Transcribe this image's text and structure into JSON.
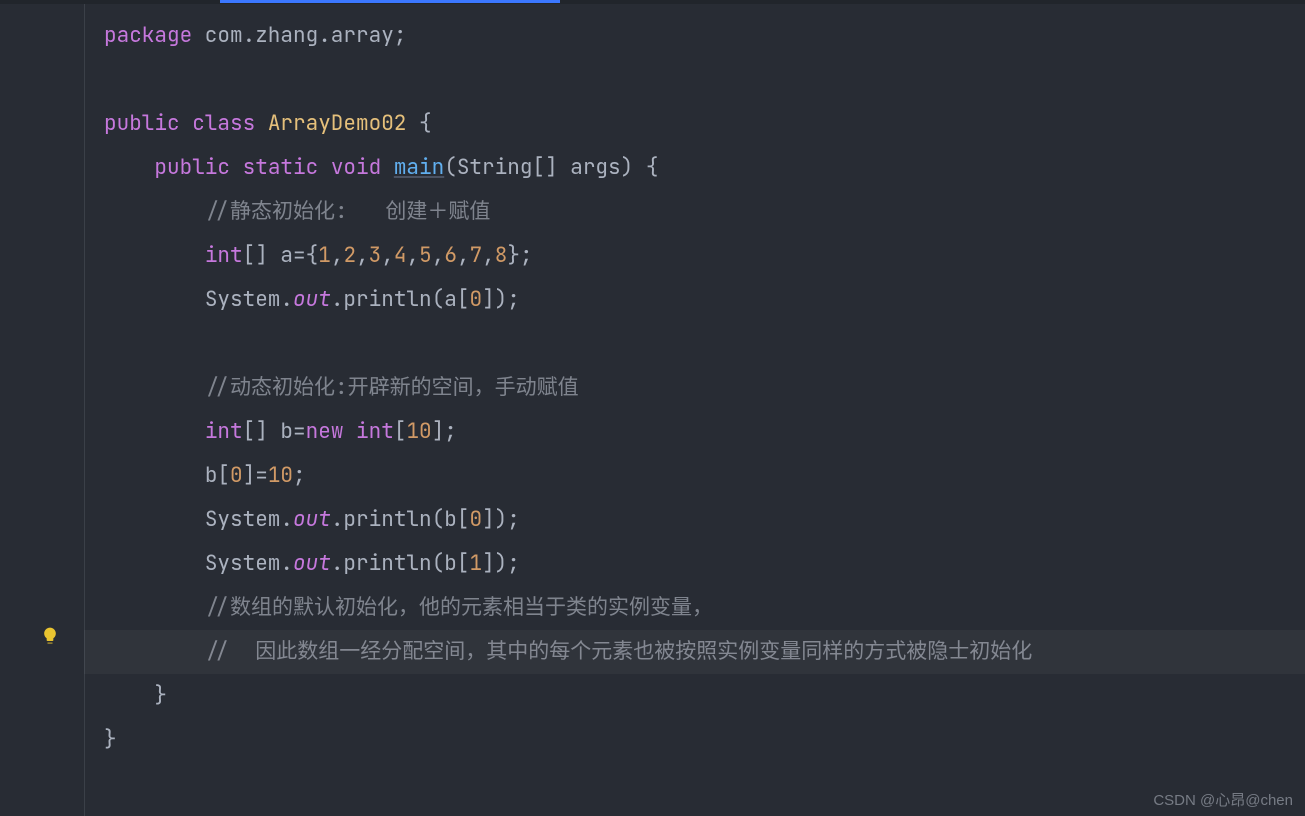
{
  "watermark": "CSDN @心昂@chen",
  "code": {
    "l1": {
      "kw": "package",
      "pkg": " com.zhang.array",
      "semi": ";"
    },
    "l3": {
      "pub": "public",
      "cls_kw": " class ",
      "cls": "ArrayDemo02",
      "brace": " {"
    },
    "l4": {
      "pub": "public",
      "stat": " static ",
      "void": "void ",
      "main": "main",
      "sig": "(String[] args) {"
    },
    "l5": {
      "c": "//静态初始化:   创建＋赋值"
    },
    "l6": {
      "t": "int",
      "arr": "[] a={",
      "n1": "1",
      "c1": ",",
      "n2": "2",
      "c2": ",",
      "n3": "3",
      "c3": ",",
      "n4": "4",
      "c4": ",",
      "n5": "5",
      "c5": ",",
      "n6": "6",
      "c6": ",",
      "n7": "7",
      "c7": ",",
      "n8": "8",
      "end": "};"
    },
    "l7": {
      "sys": "System.",
      "out": "out",
      "p": ".println(a[",
      "idx": "0",
      "end": "]);"
    },
    "l9": {
      "c": "//动态初始化:开辟新的空间，手动赋值"
    },
    "l10": {
      "t1": "int",
      "arr": "[] b=",
      "new": "new ",
      "t2": "int",
      "br": "[",
      "n": "10",
      "end": "];"
    },
    "l11": {
      "v": "b[",
      "idx": "0",
      "mid": "]=",
      "val": "10",
      "end": ";"
    },
    "l12": {
      "sys": "System.",
      "out": "out",
      "p": ".println(b[",
      "idx": "0",
      "end": "]);"
    },
    "l13": {
      "sys": "System.",
      "out": "out",
      "p": ".println(b[",
      "idx": "1",
      "end": "]);"
    },
    "l14": {
      "c": "//数组的默认初始化，他的元素相当于类的实例变量，"
    },
    "l15": {
      "c": "//  因此数组一经分配空间，其中的每个元素也被按照实例变量同样的方式被隐士初始化"
    },
    "l16": {
      "b": "}"
    },
    "l17": {
      "b": "}"
    }
  }
}
